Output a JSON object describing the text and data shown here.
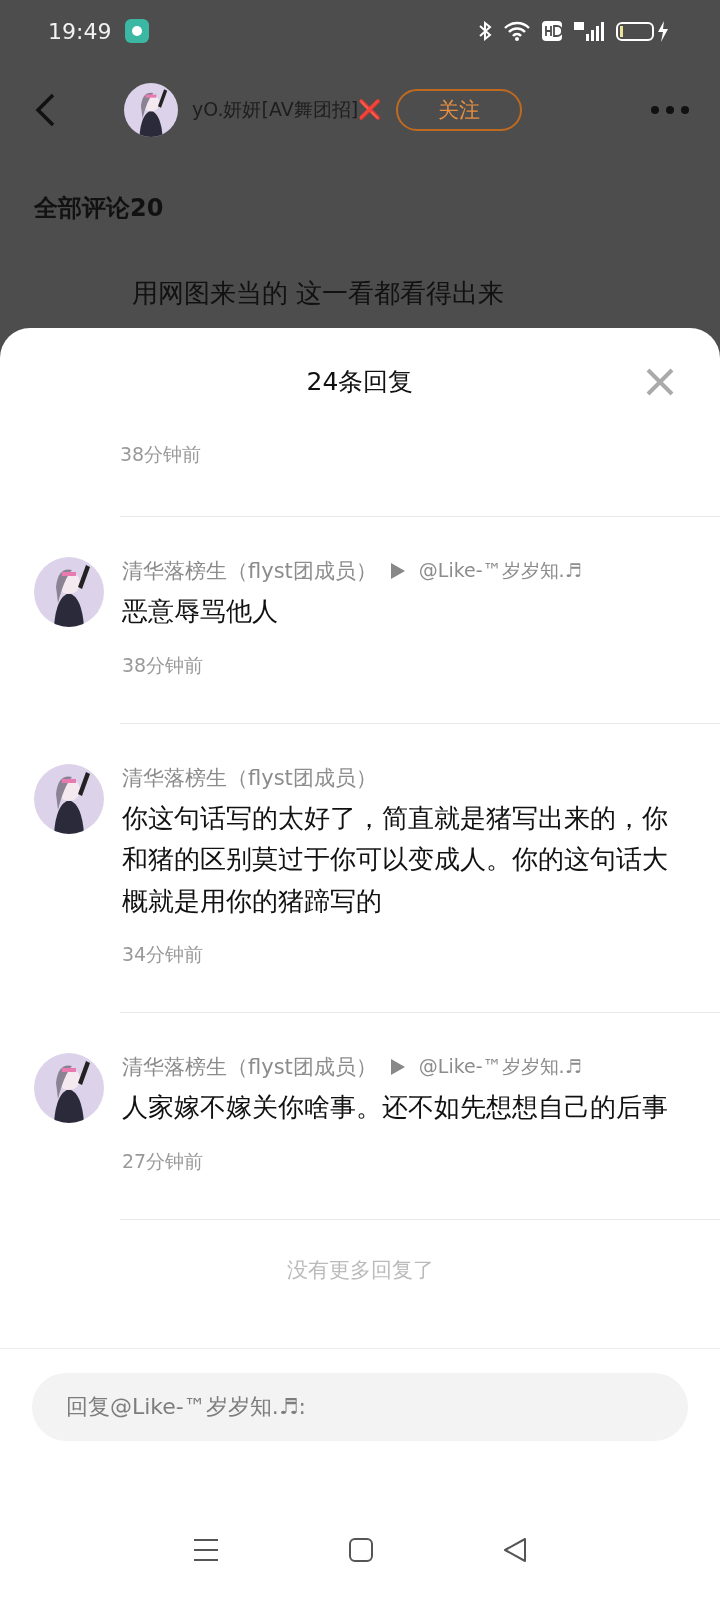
{
  "status_bar": {
    "time": "19:49"
  },
  "header": {
    "username": "yO.妍妍[AV舞团招]❌",
    "follow_label": "关注"
  },
  "comments_heading": "全部评论20",
  "background_comment": {
    "text": "用网图来当的 这一看都看得出来"
  },
  "sheet": {
    "title": "24条回复",
    "top_time": "38分钟前",
    "replies": [
      {
        "name": "清华落榜生（flyst团成员）",
        "reply_to": "@Like-™岁岁知.♬",
        "text": "恶意辱骂他人",
        "time": "38分钟前"
      },
      {
        "name": "清华落榜生（flyst团成员）",
        "text": "你这句话写的太好了，简直就是猪写出来的，你和猪的区别莫过于你可以变成人。你的这句话大概就是用你的猪蹄写的",
        "time": "34分钟前"
      },
      {
        "name": "清华落榜生（flyst团成员）",
        "reply_to": "@Like-™岁岁知.♬",
        "text": "人家嫁不嫁关你啥事。还不如先想想自己的后事",
        "time": "27分钟前"
      }
    ],
    "end_note": "没有更多回复了",
    "reply_field": {
      "placeholder": "回复@Like-™岁岁知.♬:"
    }
  }
}
